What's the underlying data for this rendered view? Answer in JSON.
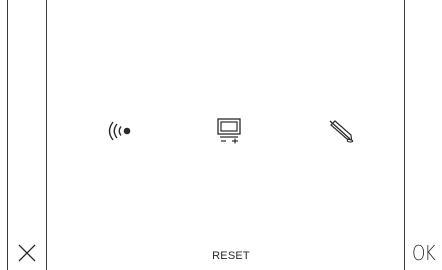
{
  "controls": {
    "cancel_icon": "close-icon",
    "ok_label": "OK",
    "reset_label": "RESET"
  },
  "icons": [
    {
      "name": "signal-strength-icon"
    },
    {
      "name": "display-adjust-icon"
    },
    {
      "name": "pen-calibrate-icon"
    }
  ],
  "colors": {
    "background": "#ffffff",
    "lines": "#3a3a3a",
    "text": "#2a2a2a"
  }
}
